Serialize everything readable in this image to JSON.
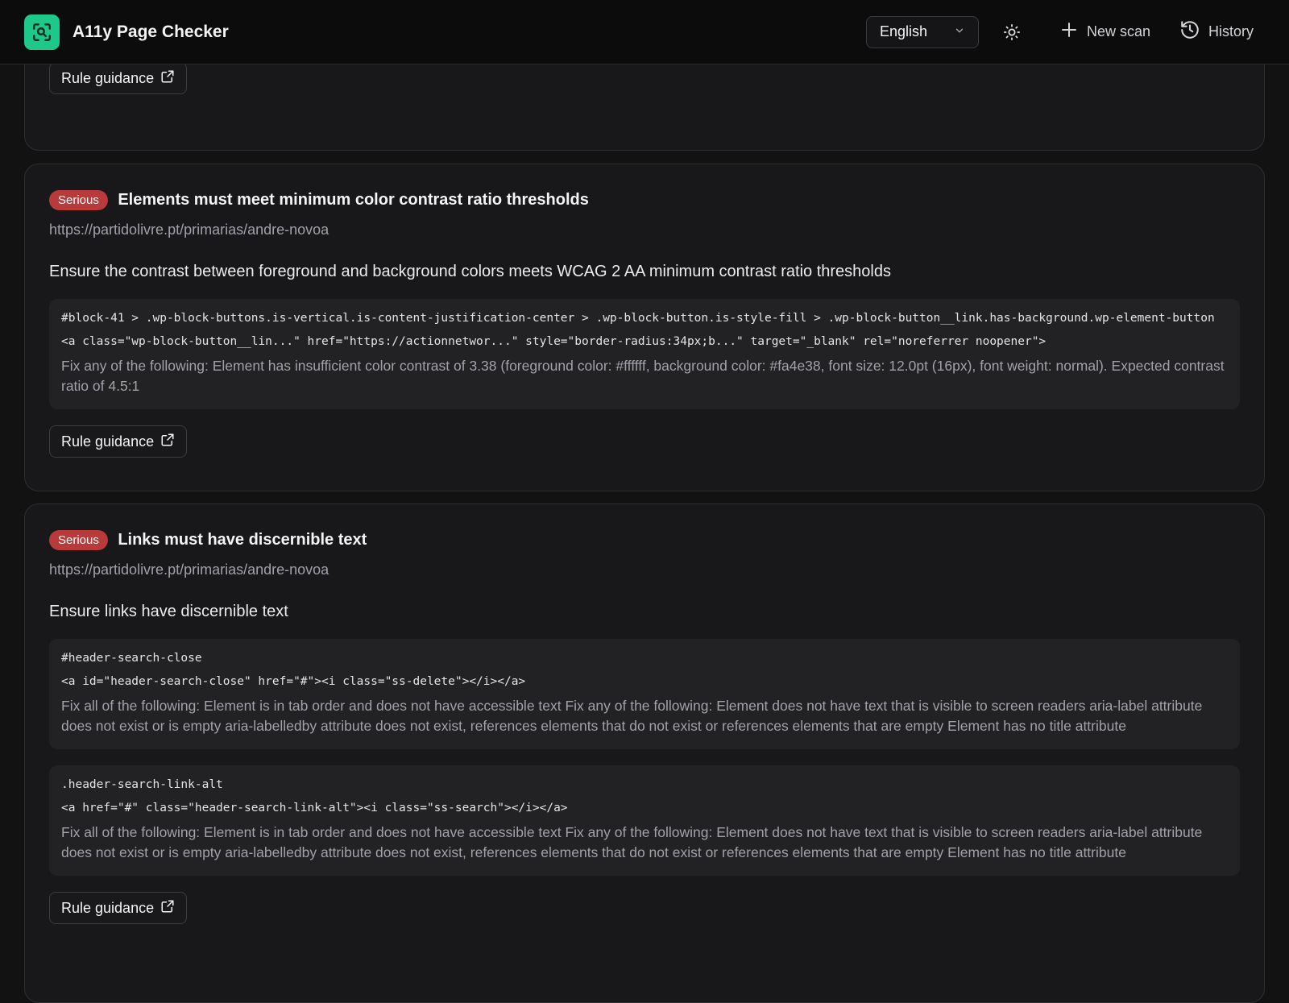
{
  "header": {
    "app_title": "A11y Page Checker",
    "logo_icon": "scan-search-icon",
    "language": "English",
    "theme_icon": "sun-icon",
    "new_scan_label": "New scan",
    "history_label": "History",
    "accent_color": "#1cc88a"
  },
  "top_card": {
    "guidance_label": "Rule guidance"
  },
  "issues": [
    {
      "severity": "Serious",
      "title": "Elements must meet minimum color contrast ratio thresholds",
      "url": "https://partidolivre.pt/primarias/andre-novoa",
      "description": "Ensure the contrast between foreground and background colors meets WCAG 2 AA minimum contrast ratio thresholds",
      "nodes": [
        {
          "selector": "#block-41 > .wp-block-buttons.is-vertical.is-content-justification-center > .wp-block-button.is-style-fill > .wp-block-button__link.has-background.wp-element-button",
          "html": "<a class=\"wp-block-button__lin...\" href=\"https://actionnetwor...\" style=\"border-radius:34px;b...\" target=\"_blank\" rel=\"noreferrer noopener\">",
          "fix": "Fix any of the following: Element has insufficient color contrast of 3.38 (foreground color: #ffffff, background color: #fa4e38, font size: 12.0pt (16px), font weight: normal). Expected contrast ratio of 4.5:1"
        }
      ],
      "guidance_label": "Rule guidance"
    },
    {
      "severity": "Serious",
      "title": "Links must have discernible text",
      "url": "https://partidolivre.pt/primarias/andre-novoa",
      "description": "Ensure links have discernible text",
      "nodes": [
        {
          "selector": "#header-search-close",
          "html": "<a id=\"header-search-close\" href=\"#\"><i class=\"ss-delete\"></i></a>",
          "fix": "Fix all of the following: Element is in tab order and does not have accessible text Fix any of the following: Element does not have text that is visible to screen readers aria-label attribute does not exist or is empty aria-labelledby attribute does not exist, references elements that do not exist or references elements that are empty Element has no title attribute"
        },
        {
          "selector": ".header-search-link-alt",
          "html": "<a href=\"#\" class=\"header-search-link-alt\"><i class=\"ss-search\"></i></a>",
          "fix": "Fix all of the following: Element is in tab order and does not have accessible text Fix any of the following: Element does not have text that is visible to screen readers aria-label attribute does not exist or is empty aria-labelledby attribute does not exist, references elements that do not exist or references elements that are empty Element has no title attribute"
        }
      ],
      "guidance_label": "Rule guidance"
    }
  ],
  "severity_color": "#b93a3a"
}
